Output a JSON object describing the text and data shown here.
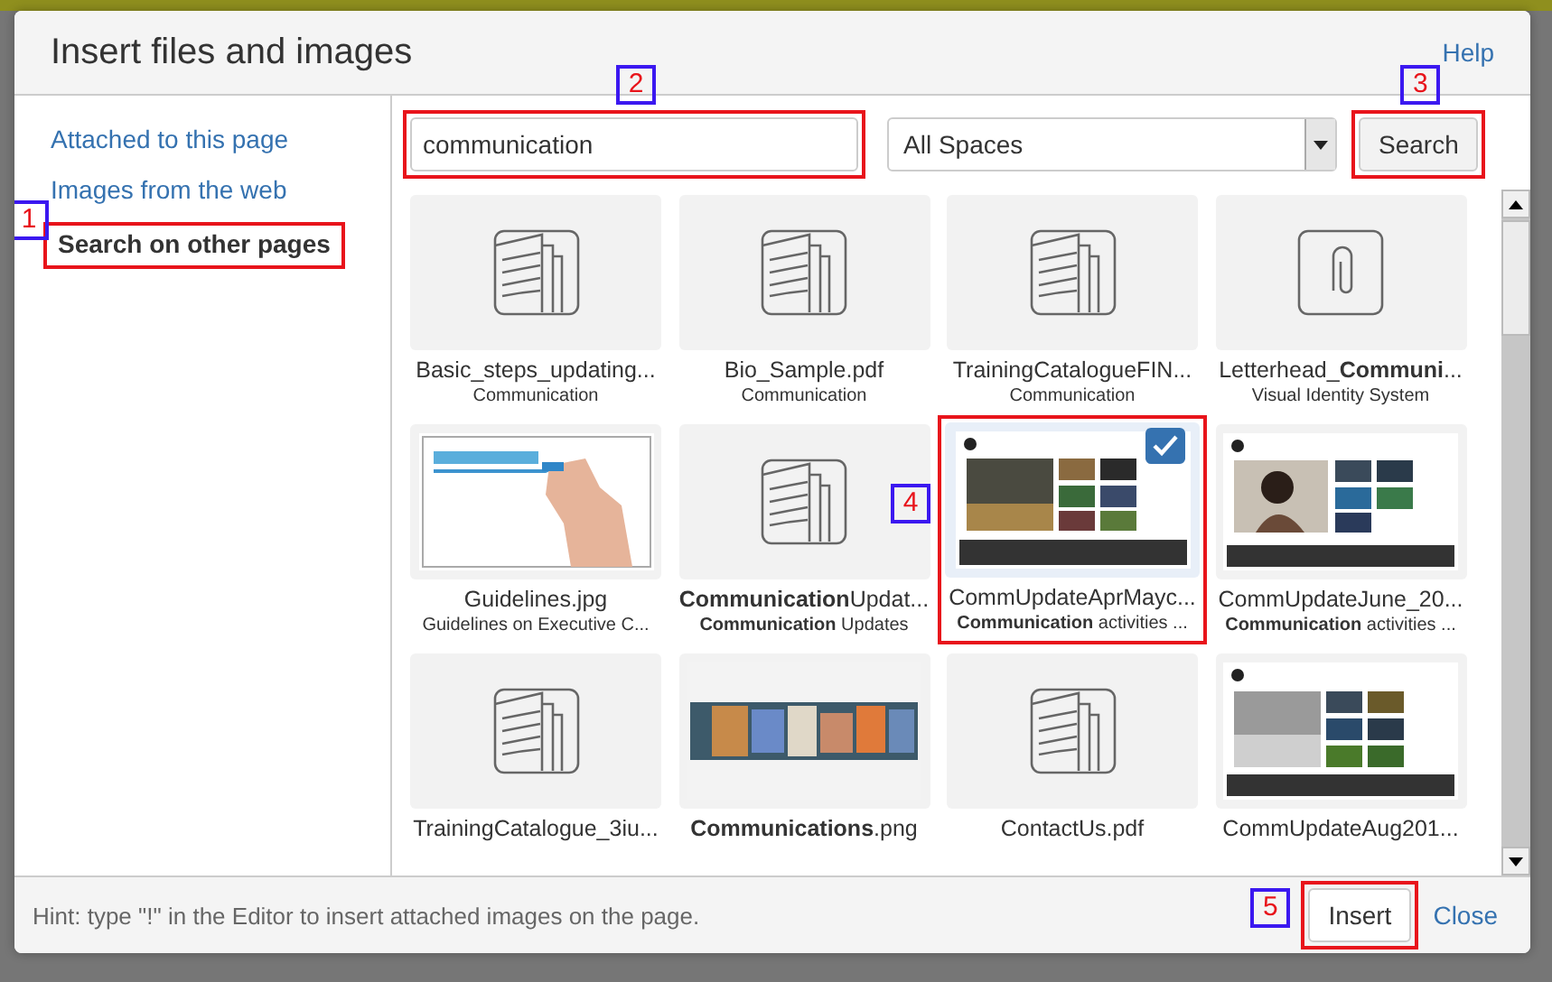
{
  "dialog": {
    "title": "Insert files and images",
    "help": "Help"
  },
  "sidebar": {
    "items": [
      {
        "label": "Attached to this page",
        "selected": false
      },
      {
        "label": "Images from the web",
        "selected": false
      },
      {
        "label": "Search on other pages",
        "selected": true,
        "callout": "1"
      }
    ]
  },
  "search": {
    "value": "communication",
    "callout": "2",
    "scope": "All Spaces",
    "button": "Search",
    "button_callout": "3"
  },
  "files": [
    {
      "kind": "document",
      "name": "Basic_steps_updating...",
      "location": "Communication",
      "selected": false
    },
    {
      "kind": "document",
      "name": "Bio_Sample.pdf",
      "location": "Communication",
      "selected": false
    },
    {
      "kind": "document",
      "name": "TrainingCatalogueFIN...",
      "location": "Communication",
      "selected": false
    },
    {
      "kind": "attachment",
      "name": "Letterhead_**Communi**...",
      "location": "Visual Identity System",
      "selected": false
    },
    {
      "kind": "picture",
      "name": "Guidelines.jpg",
      "location": "Guidelines on Executive C...",
      "selected": false
    },
    {
      "kind": "document",
      "name": "**Communication**Updat...",
      "location": "**Communication** Updates",
      "selected": false
    },
    {
      "kind": "picture",
      "name": "CommUpdateAprMayc...",
      "location": "**Communication** activities ...",
      "selected": true,
      "callout": "4"
    },
    {
      "kind": "picture",
      "name": "CommUpdateJune_20...",
      "location": "**Communication** activities ...",
      "selected": false
    },
    {
      "kind": "document",
      "name": "TrainingCatalogue_3iu...",
      "selected": false
    },
    {
      "kind": "picture",
      "name": "**Communications**.png",
      "selected": false
    },
    {
      "kind": "document",
      "name": "ContactUs.pdf",
      "selected": false
    },
    {
      "kind": "picture",
      "name": "CommUpdateAug201...",
      "selected": false
    }
  ],
  "footer": {
    "hint": "Hint: type \"!\" in the Editor to insert attached images on the page.",
    "insert": "Insert",
    "insert_callout": "5",
    "close": "Close"
  }
}
